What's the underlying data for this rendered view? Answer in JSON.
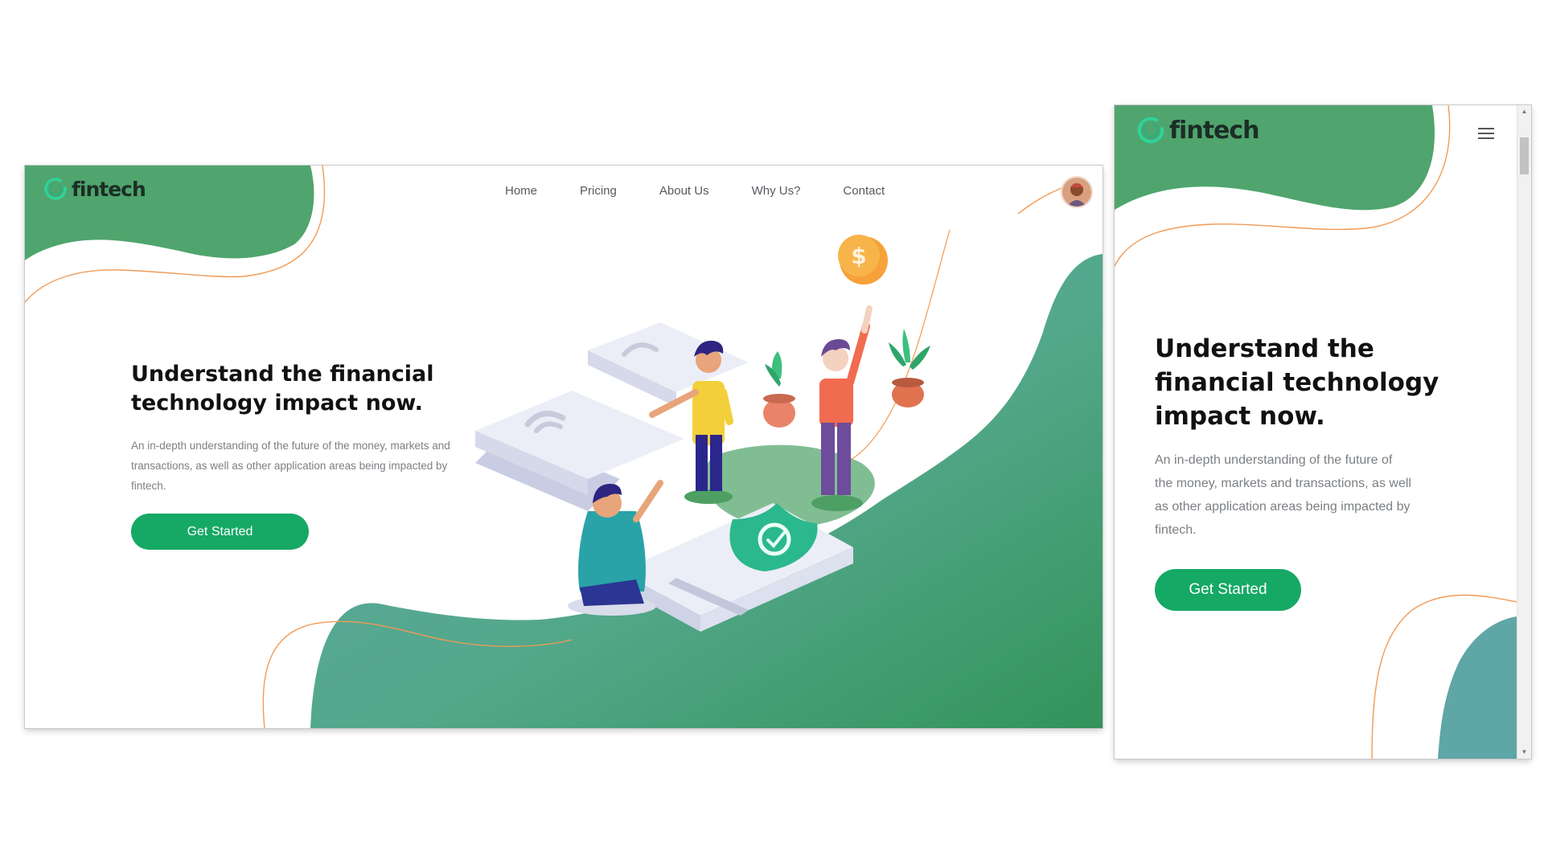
{
  "brand": {
    "name": "fintech"
  },
  "nav": [
    {
      "label": "Home"
    },
    {
      "label": "Pricing"
    },
    {
      "label": "About Us"
    },
    {
      "label": "Why Us?"
    },
    {
      "label": "Contact"
    }
  ],
  "hero": {
    "title": "Understand the financial technology impact now.",
    "description": "An in-depth understanding of the future of the money, markets and transactions, as well as other application areas being impacted by fintech.",
    "cta_label": "Get Started"
  },
  "illustration": {
    "coin_symbol": "$"
  },
  "icons": {
    "logo": "ring-logo-icon",
    "menu": "hamburger-menu-icon",
    "avatar": "user-avatar",
    "scroll_up": "scroll-up-arrow-icon",
    "scroll_down": "scroll-down-arrow-icon"
  },
  "colors": {
    "brand_green": "#4fa56d",
    "cta_green": "#16a865",
    "teal": "#5aa59e",
    "accent_orange": "#f19a55",
    "title_text": "#111111",
    "body_text": "#7b7f83",
    "nav_text": "#555a5f"
  }
}
